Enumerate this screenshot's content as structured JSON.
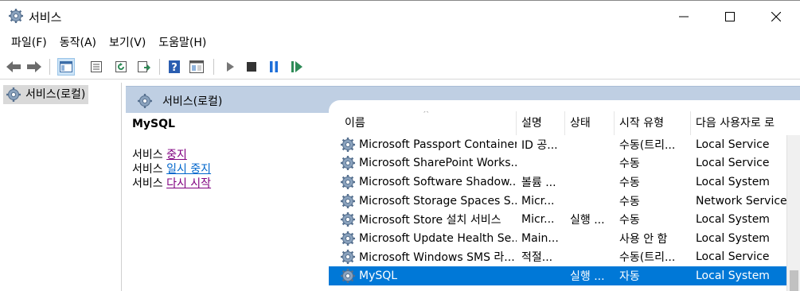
{
  "window": {
    "title": "서비스",
    "icon": "gear-icon"
  },
  "menu": [
    "파일(F)",
    "동작(A)",
    "보기(V)",
    "도움말(H)"
  ],
  "toolbar": {
    "icons": [
      "back-arrow-icon",
      "forward-arrow-icon",
      "console-tree-icon",
      "properties-icon",
      "refresh-icon",
      "export-icon",
      "help-icon",
      "show-hide-icon",
      "start-icon",
      "stop-icon",
      "pause-icon",
      "restart-icon"
    ],
    "colors": {
      "arrow": "#2e8b57",
      "help": "#2a5db0",
      "stop": "#333333",
      "pause": "#1e6fd9"
    }
  },
  "tree": {
    "root_label": "서비스(로컬)"
  },
  "content": {
    "header_label": "서비스(로컬)",
    "selected_service": "MySQL",
    "actions": [
      {
        "prefix": "서비스 ",
        "link": "중지"
      },
      {
        "prefix": "서비스 ",
        "link": "일시 중지"
      },
      {
        "prefix": "서비스 ",
        "link": "다시 시작"
      }
    ]
  },
  "table": {
    "sort_indicator": "^",
    "columns": [
      "이름",
      "설명",
      "상태",
      "시작 유형",
      "다음 사용자로 로"
    ],
    "rows": [
      {
        "name": "Microsoft Passport Container",
        "desc": "ID 공...",
        "status": "",
        "start": "수동(트리...",
        "logon": "Local Service"
      },
      {
        "name": "Microsoft SharePoint Works...",
        "desc": "",
        "status": "",
        "start": "수동",
        "logon": "Local Service"
      },
      {
        "name": "Microsoft Software Shadow...",
        "desc": "볼륨 ...",
        "status": "",
        "start": "수동",
        "logon": "Local System"
      },
      {
        "name": "Microsoft Storage Spaces S...",
        "desc": "Micr...",
        "status": "",
        "start": "수동",
        "logon": "Network Service"
      },
      {
        "name": "Microsoft Store 설치 서비스",
        "desc": "Micr...",
        "status": "실행 ...",
        "start": "수동",
        "logon": "Local System"
      },
      {
        "name": "Microsoft Update Health Se...",
        "desc": "Main...",
        "status": "",
        "start": "사용 안 함",
        "logon": "Local System"
      },
      {
        "name": "Microsoft Windows SMS 라...",
        "desc": "적절...",
        "status": "",
        "start": "수동(트리...",
        "logon": "Local Service"
      },
      {
        "name": "MySQL",
        "desc": "",
        "status": "실행 ...",
        "start": "자동",
        "logon": "Local System",
        "selected": true
      }
    ]
  },
  "colors": {
    "selection": "#0078d7",
    "header_band": "#bfcfe3",
    "link": "#800080",
    "link_blue": "#0066cc"
  }
}
